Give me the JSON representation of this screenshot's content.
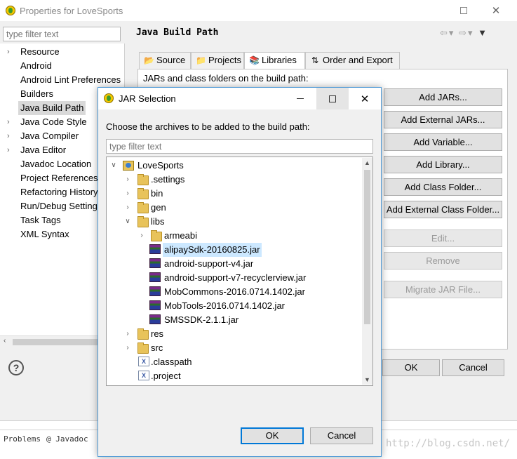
{
  "properties_window": {
    "title": "Properties for LoveSports",
    "filter_placeholder": "type filter text",
    "categories": [
      {
        "label": "Resource",
        "expandable": true
      },
      {
        "label": "Android",
        "expandable": false
      },
      {
        "label": "Android Lint Preferences",
        "expandable": false
      },
      {
        "label": "Builders",
        "expandable": false
      },
      {
        "label": "Java Build Path",
        "expandable": false,
        "selected": true
      },
      {
        "label": "Java Code Style",
        "expandable": true
      },
      {
        "label": "Java Compiler",
        "expandable": true
      },
      {
        "label": "Java Editor",
        "expandable": true
      },
      {
        "label": "Javadoc Location",
        "expandable": false
      },
      {
        "label": "Project References",
        "expandable": false
      },
      {
        "label": "Refactoring History",
        "expandable": false
      },
      {
        "label": "Run/Debug Settings",
        "expandable": false
      },
      {
        "label": "Task Tags",
        "expandable": false
      },
      {
        "label": "XML Syntax",
        "expandable": false
      }
    ],
    "page_title": "Java Build Path",
    "tabs": [
      {
        "label": "Source",
        "icon": "source-folder-icon"
      },
      {
        "label": "Projects",
        "icon": "projects-icon"
      },
      {
        "label": "Libraries",
        "icon": "libraries-icon",
        "active": true
      },
      {
        "label": "Order and Export",
        "icon": "order-export-icon"
      }
    ],
    "jars_label": "JARs and class folders on the build path:",
    "buttons": {
      "add_jars": "Add JARs...",
      "add_external_jars": "Add External JARs...",
      "add_variable": "Add Variable...",
      "add_library": "Add Library...",
      "add_class_folder": "Add Class Folder...",
      "add_external_class_folder": "Add External Class Folder...",
      "edit": "Edit...",
      "remove": "Remove",
      "migrate_jar": "Migrate JAR File...",
      "ok": "OK",
      "cancel": "Cancel"
    }
  },
  "bottom_panel": {
    "problems": "Problems",
    "javadoc": "@ Javadoc"
  },
  "watermark": "http://blog.csdn.net/",
  "jar_dialog": {
    "title": "JAR Selection",
    "instruction": "Choose the archives to be added to the build path:",
    "filter_placeholder": "type filter text",
    "tree": {
      "project": "LoveSports",
      "settings": ".settings",
      "bin": "bin",
      "gen": "gen",
      "libs": "libs",
      "armeabi": "armeabi",
      "jars": [
        "alipaySdk-20160825.jar",
        "android-support-v4.jar",
        "android-support-v7-recyclerview.jar",
        "MobCommons-2016.0714.1402.jar",
        "MobTools-2016.0714.1402.jar",
        "SMSSDK-2.1.1.jar"
      ],
      "selected_jar": "alipaySdk-20160825.jar",
      "res": "res",
      "src": "src",
      "classpath": ".classpath",
      "project_file": ".project"
    },
    "ok": "OK",
    "cancel": "Cancel"
  },
  "colors": {
    "selection": "#cce8ff",
    "dialog_border": "#4f9ad6",
    "window_bg": "#f0f0f0"
  }
}
